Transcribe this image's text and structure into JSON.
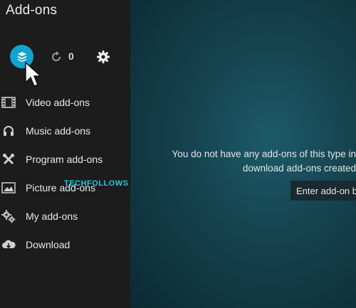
{
  "header": {
    "title": "Add-ons"
  },
  "toolbar": {
    "update_count": "0"
  },
  "menu": {
    "items": [
      {
        "label": "Video add-ons",
        "icon": "film-icon"
      },
      {
        "label": "Music add-ons",
        "icon": "headphones-icon"
      },
      {
        "label": "Program add-ons",
        "icon": "tools-icon"
      },
      {
        "label": "Picture add-ons",
        "icon": "picture-icon"
      },
      {
        "label": "My add-ons",
        "icon": "gears-icon"
      },
      {
        "label": "Download",
        "icon": "cloud-download-icon"
      }
    ]
  },
  "main": {
    "message_line1": "You do not have any add-ons of this type in",
    "message_line2": "download add-ons created",
    "enter_button": "Enter add-on b"
  },
  "watermark": "TECHFOLLOWS",
  "colors": {
    "accent": "#12a3cf",
    "sidebar": "#1c1c1c",
    "background": "#14414d"
  }
}
